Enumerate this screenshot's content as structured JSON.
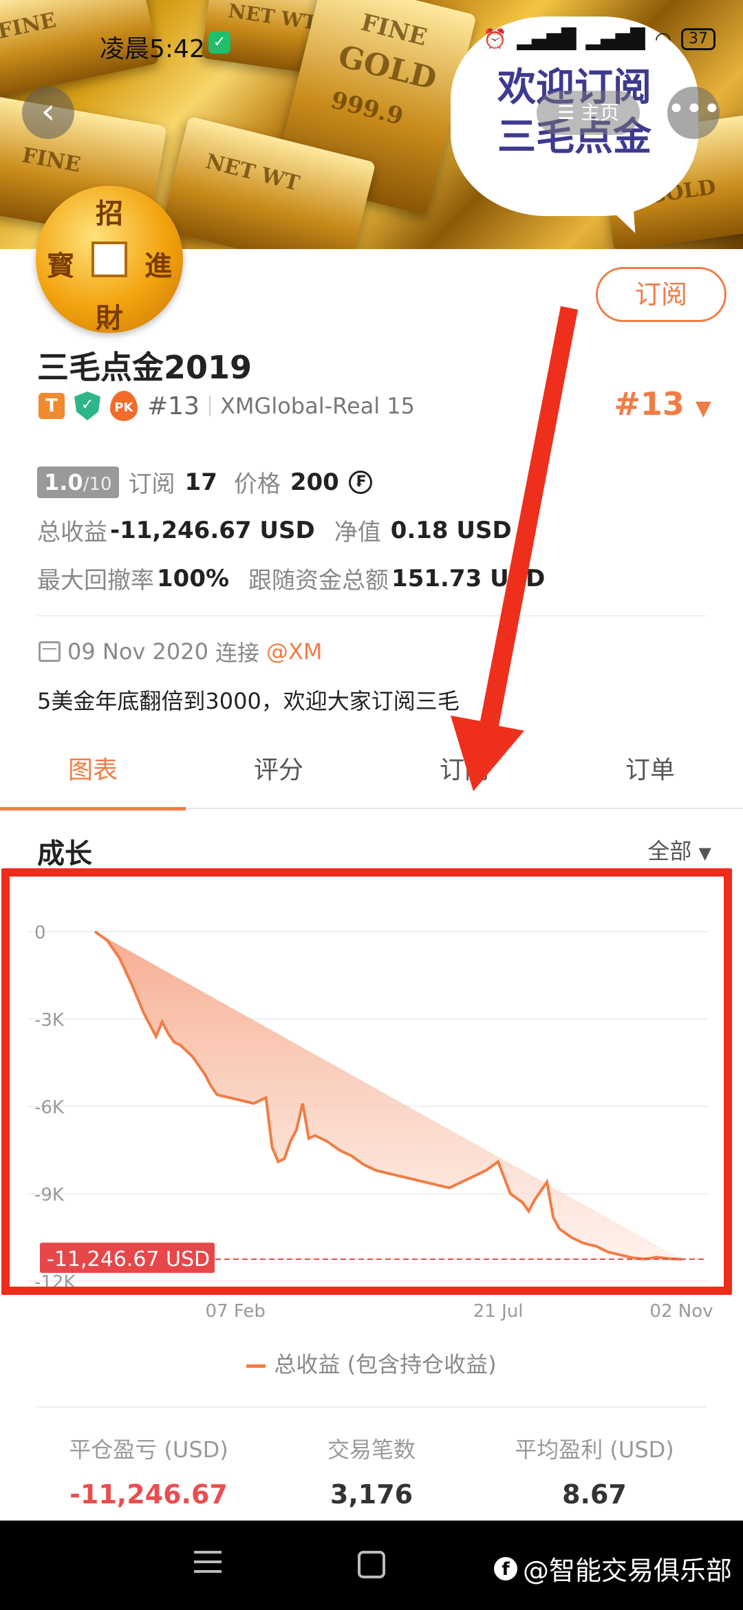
{
  "status_bar": {
    "time": "凌晨5:42",
    "battery": "37"
  },
  "header": {
    "home_label": "主页",
    "bubble_text_line1": "欢迎订阅",
    "bubble_text_line2": "三毛点金",
    "gold_bar_texts": [
      "FINE",
      "GOLD",
      "999.9",
      "NET WT"
    ]
  },
  "avatar": {
    "chars": [
      "招",
      "財",
      "寳",
      "進"
    ]
  },
  "subscribe_button": "订阅",
  "profile": {
    "name": "三毛点金2019",
    "badge_t": "T",
    "badge_pk": "PK",
    "rank": "#13",
    "server": "XMGlobal-Real 15",
    "rank_right": "#13"
  },
  "stats": {
    "score": "1.0",
    "score_max": "/10",
    "subscribe_label": "订阅",
    "subscribe_count": "17",
    "price_label": "价格",
    "price_value": "200",
    "total_profit_label": "总收益",
    "total_profit_value": "-11,246.67 USD",
    "net_value_label": "净值",
    "net_value_value": "0.18 USD",
    "max_drawdown_label": "最大回撤率",
    "max_drawdown_value": "100%",
    "follow_funds_label": "跟随资金总额",
    "follow_funds_value": "151.73 USD"
  },
  "connect": {
    "date": "09 Nov 2020",
    "connect_label": "连接",
    "broker": "@XM"
  },
  "description": "5美金年底翻倍到3000，欢迎大家订阅三毛",
  "tabs": [
    {
      "label": "图表"
    },
    {
      "label": "评分"
    },
    {
      "label": "订阅"
    },
    {
      "label": "订单"
    }
  ],
  "growth_title": "成长",
  "range_select": "全部",
  "chart_data": {
    "type": "area",
    "y_ticks": [
      "0",
      "-3K",
      "-6K",
      "-9K",
      "-12K"
    ],
    "ylim": [
      -12000,
      0
    ],
    "x_ticks": [
      {
        "label": "07 Feb",
        "pos": 0.23
      },
      {
        "label": "21 Jul",
        "pos": 0.66
      },
      {
        "label": "02 Nov",
        "pos": 0.96
      }
    ],
    "x": [
      0,
      0.02,
      0.04,
      0.06,
      0.08,
      0.09,
      0.1,
      0.11,
      0.12,
      0.13,
      0.14,
      0.15,
      0.16,
      0.17,
      0.18,
      0.19,
      0.2,
      0.22,
      0.24,
      0.26,
      0.28,
      0.29,
      0.3,
      0.31,
      0.32,
      0.33,
      0.34,
      0.35,
      0.36,
      0.38,
      0.4,
      0.42,
      0.44,
      0.46,
      0.48,
      0.5,
      0.52,
      0.54,
      0.56,
      0.58,
      0.6,
      0.62,
      0.64,
      0.66,
      0.68,
      0.7,
      0.71,
      0.72,
      0.73,
      0.74,
      0.75,
      0.76,
      0.78,
      0.8,
      0.82,
      0.84,
      0.86,
      0.88,
      0.9,
      0.92,
      0.94,
      0.96,
      0.98,
      1.0
    ],
    "values": [
      0,
      -300,
      -900,
      -1800,
      -2800,
      -3200,
      -3600,
      -3100,
      -3500,
      -3800,
      -3900,
      -4100,
      -4300,
      -4600,
      -4900,
      -5300,
      -5600,
      -5700,
      -5800,
      -5900,
      -5700,
      -7400,
      -7900,
      -7800,
      -7200,
      -6800,
      -5900,
      -7100,
      -7000,
      -7200,
      -7500,
      -7700,
      -8000,
      -8200,
      -8300,
      -8400,
      -8500,
      -8600,
      -8700,
      -8800,
      -8600,
      -8400,
      -8200,
      -7900,
      -9000,
      -9300,
      -9600,
      -9200,
      -8900,
      -8600,
      -9800,
      -10200,
      -10500,
      -10700,
      -10800,
      -11000,
      -11100,
      -11200,
      -11240,
      -11180,
      -11230,
      -11246
    ],
    "current_label": "-11,246.67 USD",
    "current_value": -11246.67,
    "legend": "总收益 (包含持仓收益)",
    "line_color": "#f07d45"
  },
  "bottom_stats": {
    "closed_pl_label": "平仓盈亏 (USD)",
    "closed_pl_value": "-11,246.67",
    "trades_label": "交易笔数",
    "trades_value": "3,176",
    "avg_profit_label": "平均盈利 (USD)",
    "avg_profit_value": "8.67"
  },
  "watermark": "@智能交易俱乐部"
}
